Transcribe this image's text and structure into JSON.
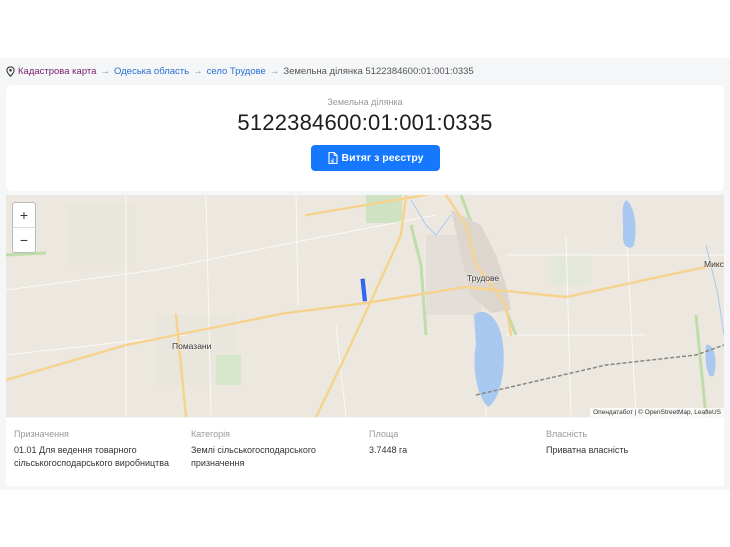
{
  "breadcrumb": {
    "items": [
      "Кадастрова карта",
      "Одеська область",
      "село Трудове"
    ],
    "current": "Земельна ділянка 5122384600:01:001:0335",
    "separator": "→"
  },
  "parcel": {
    "subtitle": "Земельна ділянка",
    "cadastral_number": "5122384600:01:001:0335",
    "extract_button": "Витяг з реєстру"
  },
  "map": {
    "zoom_in": "+",
    "zoom_out": "−",
    "labels": [
      "Трудове",
      "Помазани",
      "Микс"
    ],
    "attribution": "Опендатабот | © OpenStreetMap, LeafleUS"
  },
  "details": {
    "purpose_label": "Призначення",
    "purpose_value": "01.01 Для ведення товарного сільськогосподарського виробництва",
    "category_label": "Категорія",
    "category_value": "Землі сільськогосподарського призначення",
    "area_label": "Площа",
    "area_value": "3.7448 га",
    "ownership_label": "Власність",
    "ownership_value": "Приватна власність"
  },
  "colors": {
    "primary": "#1677ff",
    "home_link": "#7a1f6e",
    "link": "#2a6fd6",
    "parcel": "#2f6bff",
    "water": "#a9c8f0",
    "road": "#f6d38d"
  }
}
